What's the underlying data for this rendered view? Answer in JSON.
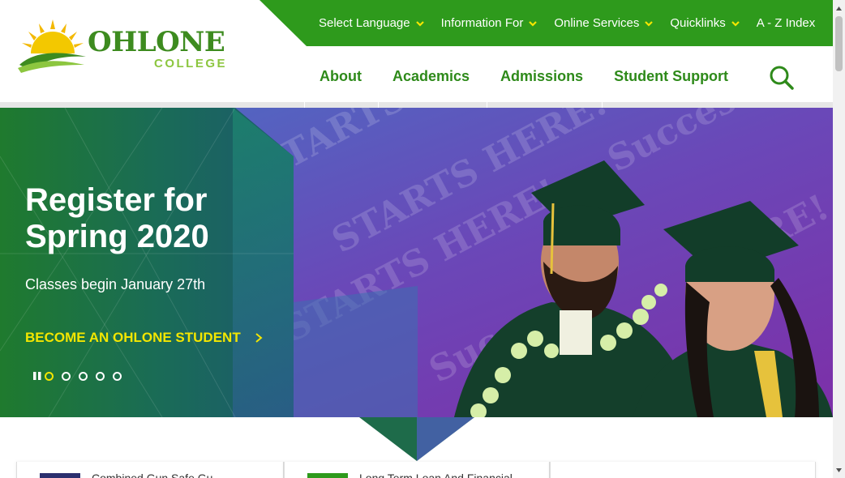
{
  "brand": {
    "name": "OHLONE",
    "sub": "COLLEGE",
    "colors": {
      "green": "#3d8b1f",
      "lime": "#8cc63f",
      "yellow": "#f3e600",
      "util_bar": "#2e9a1c"
    }
  },
  "utility_nav": [
    {
      "label": "Select Language",
      "icon": "chevron-down-icon"
    },
    {
      "label": "Information For",
      "icon": "chevron-down-icon"
    },
    {
      "label": "Online Services",
      "icon": "chevron-down-icon"
    },
    {
      "label": "Quicklinks",
      "icon": "chevron-down-icon"
    },
    {
      "label": "A - Z Index"
    }
  ],
  "main_nav": [
    {
      "label": "About"
    },
    {
      "label": "Academics"
    },
    {
      "label": "Admissions"
    },
    {
      "label": "Student Support"
    }
  ],
  "search": {
    "icon": "search-icon"
  },
  "hero": {
    "title": "Register for Spring 2020",
    "subtitle": "Classes begin January 27th",
    "cta": "BECOME AN OHLONE STUDENT",
    "cta_icon": "chevron-right-icon",
    "slides_total": 5,
    "active_slide": 1,
    "backdrop_words": "Success STARTS HERE!"
  },
  "cards": [
    {
      "text": "Combined Gun Safe Gu",
      "tag_color": "#2b2f6e"
    },
    {
      "text": "Long Term Loan And Financial",
      "tag_color": "#2e9a1c"
    },
    {
      "text": ""
    }
  ]
}
